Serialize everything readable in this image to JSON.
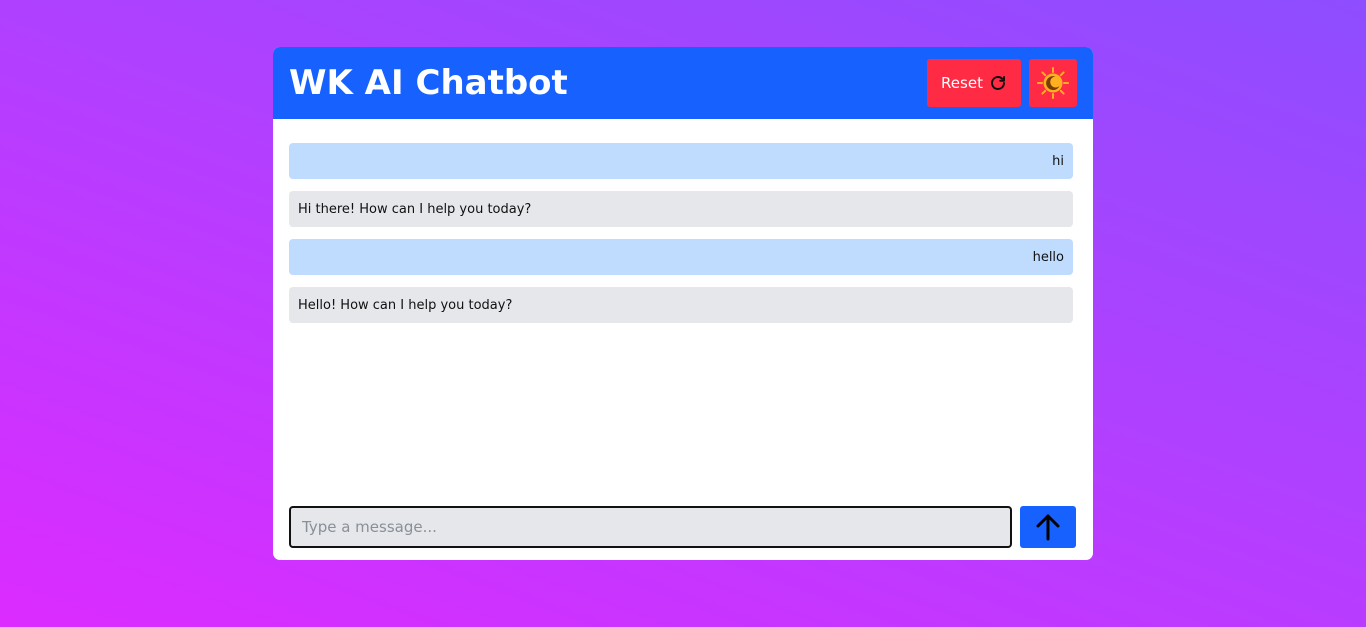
{
  "header": {
    "title": "WK AI Chatbot",
    "reset_label": "Reset",
    "reset_icon": "refresh-icon",
    "theme_icon": "sun-moon-icon"
  },
  "messages": [
    {
      "role": "user",
      "text": "hi"
    },
    {
      "role": "bot",
      "text": "Hi there! How can I help you today?"
    },
    {
      "role": "user",
      "text": "hello"
    },
    {
      "role": "bot",
      "text": "Hello! How can I help you today?"
    }
  ],
  "composer": {
    "placeholder": "Type a message...",
    "value": "",
    "send_icon": "arrow-up-icon"
  },
  "colors": {
    "header_bg": "#1762ff",
    "reset_bg": "#ff2b44",
    "user_bubble": "#bfdbfe",
    "bot_bubble": "#e5e7eb",
    "send_bg": "#1762ff"
  }
}
